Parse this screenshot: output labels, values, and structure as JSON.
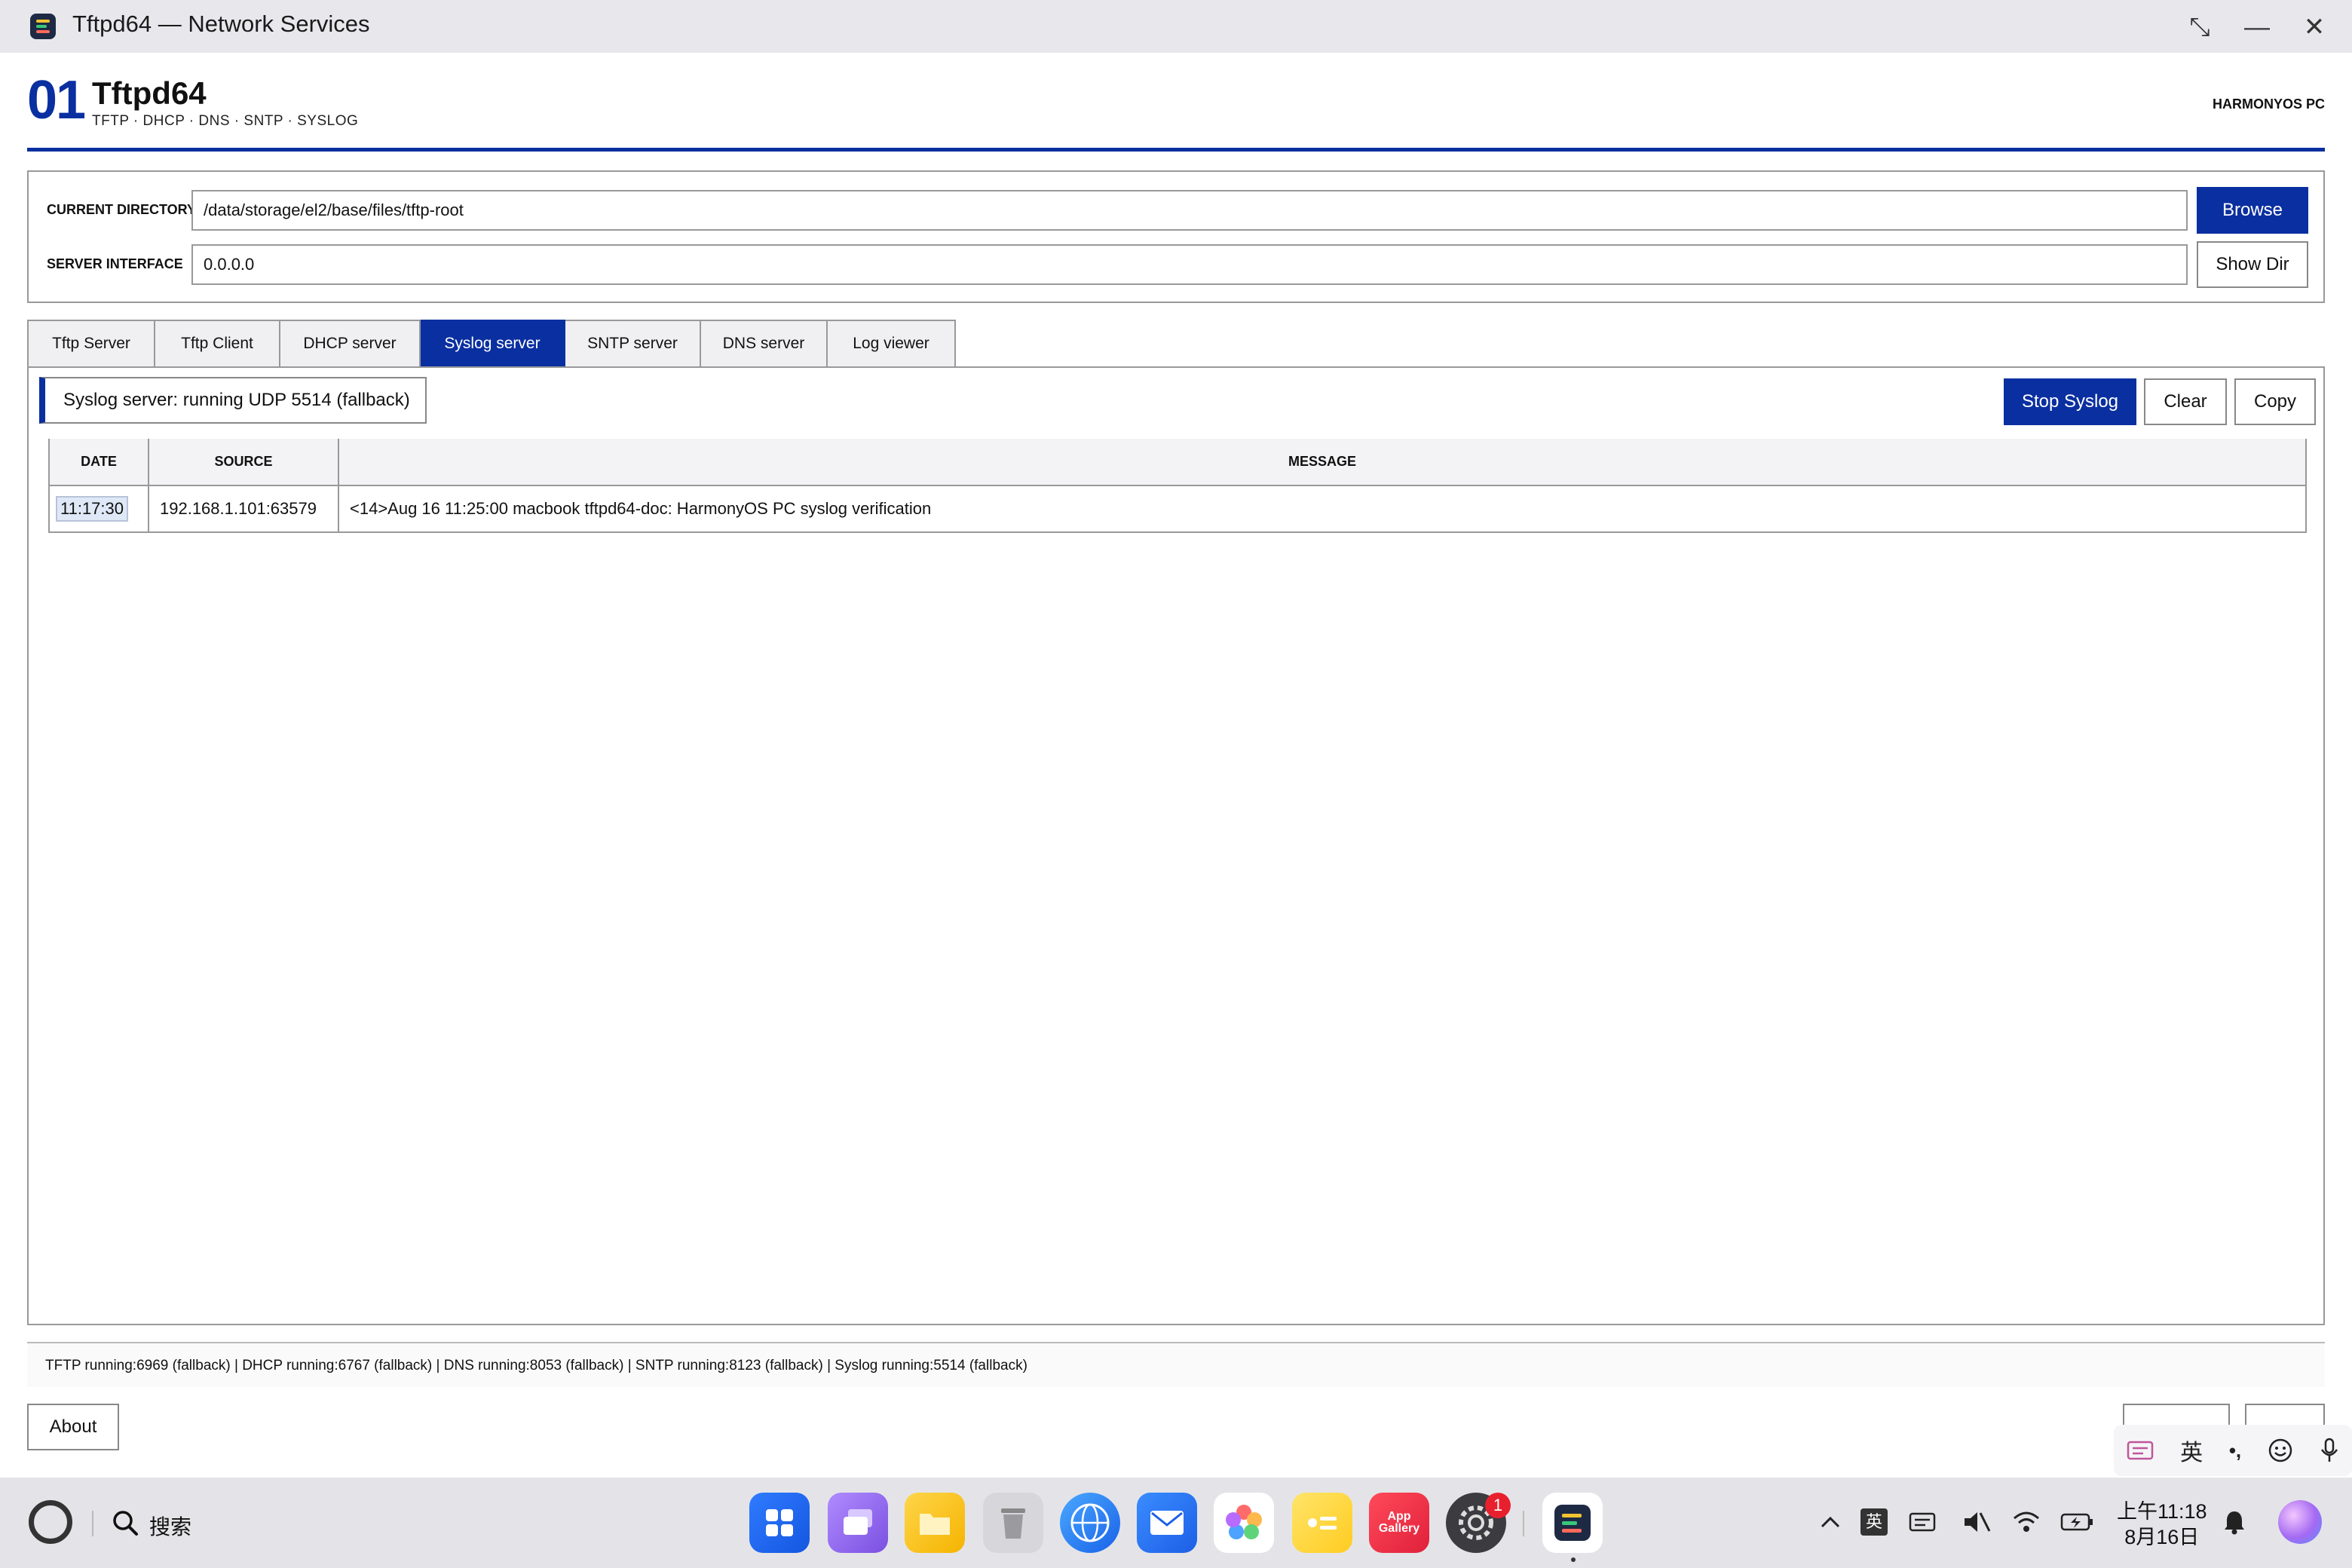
{
  "window": {
    "title": "Tftpd64 — Network Services",
    "restore_glyph": "⤡",
    "minimize_glyph": "—",
    "close_glyph": "✕"
  },
  "header": {
    "number": "01",
    "app_name": "Tftpd64",
    "protocols": "TFTP · DHCP · DNS · SNTP · SYSLOG",
    "platform": "HARMONYOS PC"
  },
  "settings": {
    "current_directory_label": "CURRENT DIRECTORY",
    "current_directory_value": "/data/storage/el2/base/files/tftp-root",
    "browse_label": "Browse",
    "server_interface_label": "SERVER INTERFACE",
    "server_interface_value": "0.0.0.0",
    "show_dir_label": "Show Dir"
  },
  "tabs": [
    {
      "label": "Tftp Server",
      "active": false
    },
    {
      "label": "Tftp Client",
      "active": false
    },
    {
      "label": "DHCP server",
      "active": false
    },
    {
      "label": "Syslog server",
      "active": true
    },
    {
      "label": "SNTP server",
      "active": false
    },
    {
      "label": "DNS server",
      "active": false
    },
    {
      "label": "Log viewer",
      "active": false
    }
  ],
  "syslog": {
    "status": "Syslog server: running  UDP 5514 (fallback)",
    "stop_label": "Stop Syslog",
    "clear_label": "Clear",
    "copy_label": "Copy",
    "columns": [
      "DATE",
      "SOURCE",
      "MESSAGE"
    ],
    "rows": [
      {
        "date": "11:17:30",
        "source": "192.168.1.101:63579",
        "message": "<14>Aug 16 11:25:00 macbook tftpd64-doc: HarmonyOS PC syslog verification"
      }
    ]
  },
  "footer": {
    "status_line": "TFTP running:6969 (fallback) | DHCP running:6767 (fallback) | DNS running:8053 (fallback) | SNTP running:8123 (fallback) | Syslog running:5514 (fallback)",
    "about_label": "About"
  },
  "ime": {
    "lang": "英",
    "punct": "•,"
  },
  "taskbar": {
    "search_label": "搜索",
    "app_gallery_label": "App Gallery",
    "settings_badge": "1",
    "tray_lang": "英",
    "time": "上午11:18",
    "date": "8月16日"
  },
  "colors": {
    "accent": "#0a2fa0",
    "badge": "#e8202e"
  }
}
